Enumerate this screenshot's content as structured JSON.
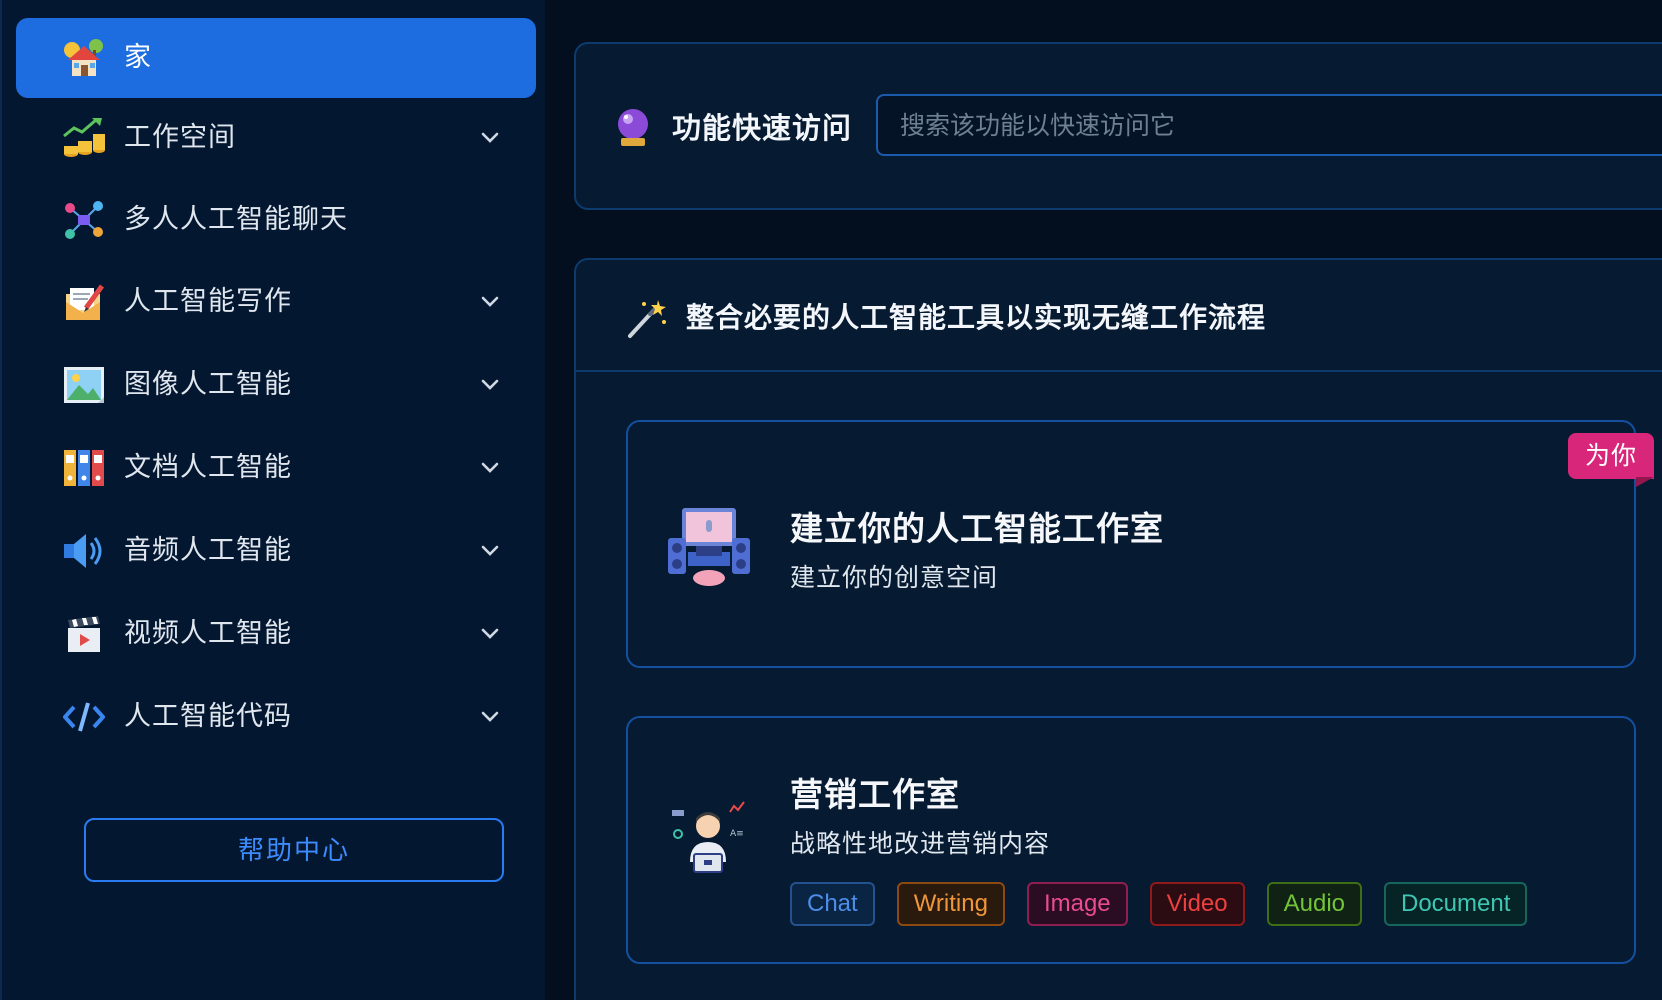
{
  "sidebar": {
    "items": [
      {
        "label": "家",
        "icon": "home-icon",
        "active": true,
        "expandable": false
      },
      {
        "label": "工作空间",
        "icon": "growth-chart-icon",
        "expandable": true
      },
      {
        "label": "多人人工智能聊天",
        "icon": "network-icon",
        "expandable": false
      },
      {
        "label": "人工智能写作",
        "icon": "envelope-pencil-icon",
        "expandable": true
      },
      {
        "label": "图像人工智能",
        "icon": "picture-icon",
        "expandable": true
      },
      {
        "label": "文档人工智能",
        "icon": "binders-icon",
        "expandable": true
      },
      {
        "label": "音频人工智能",
        "icon": "speaker-icon",
        "expandable": true
      },
      {
        "label": "视频人工智能",
        "icon": "clapperboard-icon",
        "expandable": true
      },
      {
        "label": "人工智能代码",
        "icon": "code-icon",
        "expandable": true
      }
    ],
    "help_label": "帮助中心"
  },
  "quick_access": {
    "title": "功能快速访问",
    "search_placeholder": "搜索该功能以快速访问它",
    "icon": "crystal-ball-icon"
  },
  "tools": {
    "title": "整合必要的人工智能工具以实现无缝工作流程",
    "icon": "magic-wand-icon",
    "cards": [
      {
        "title": "建立你的人工智能工作室",
        "subtitle": "建立你的创意空间",
        "badge": "为你",
        "icon": "studio-desk-icon"
      },
      {
        "title": "营销工作室",
        "subtitle": "战略性地改进营销内容",
        "icon": "marketer-icon",
        "tags": [
          "Chat",
          "Writing",
          "Image",
          "Video",
          "Audio",
          "Document"
        ]
      }
    ]
  },
  "colors": {
    "accent": "#1d6ce0",
    "background": "#030f1e",
    "sidebar": "#041730",
    "badge": "#d8277b"
  }
}
